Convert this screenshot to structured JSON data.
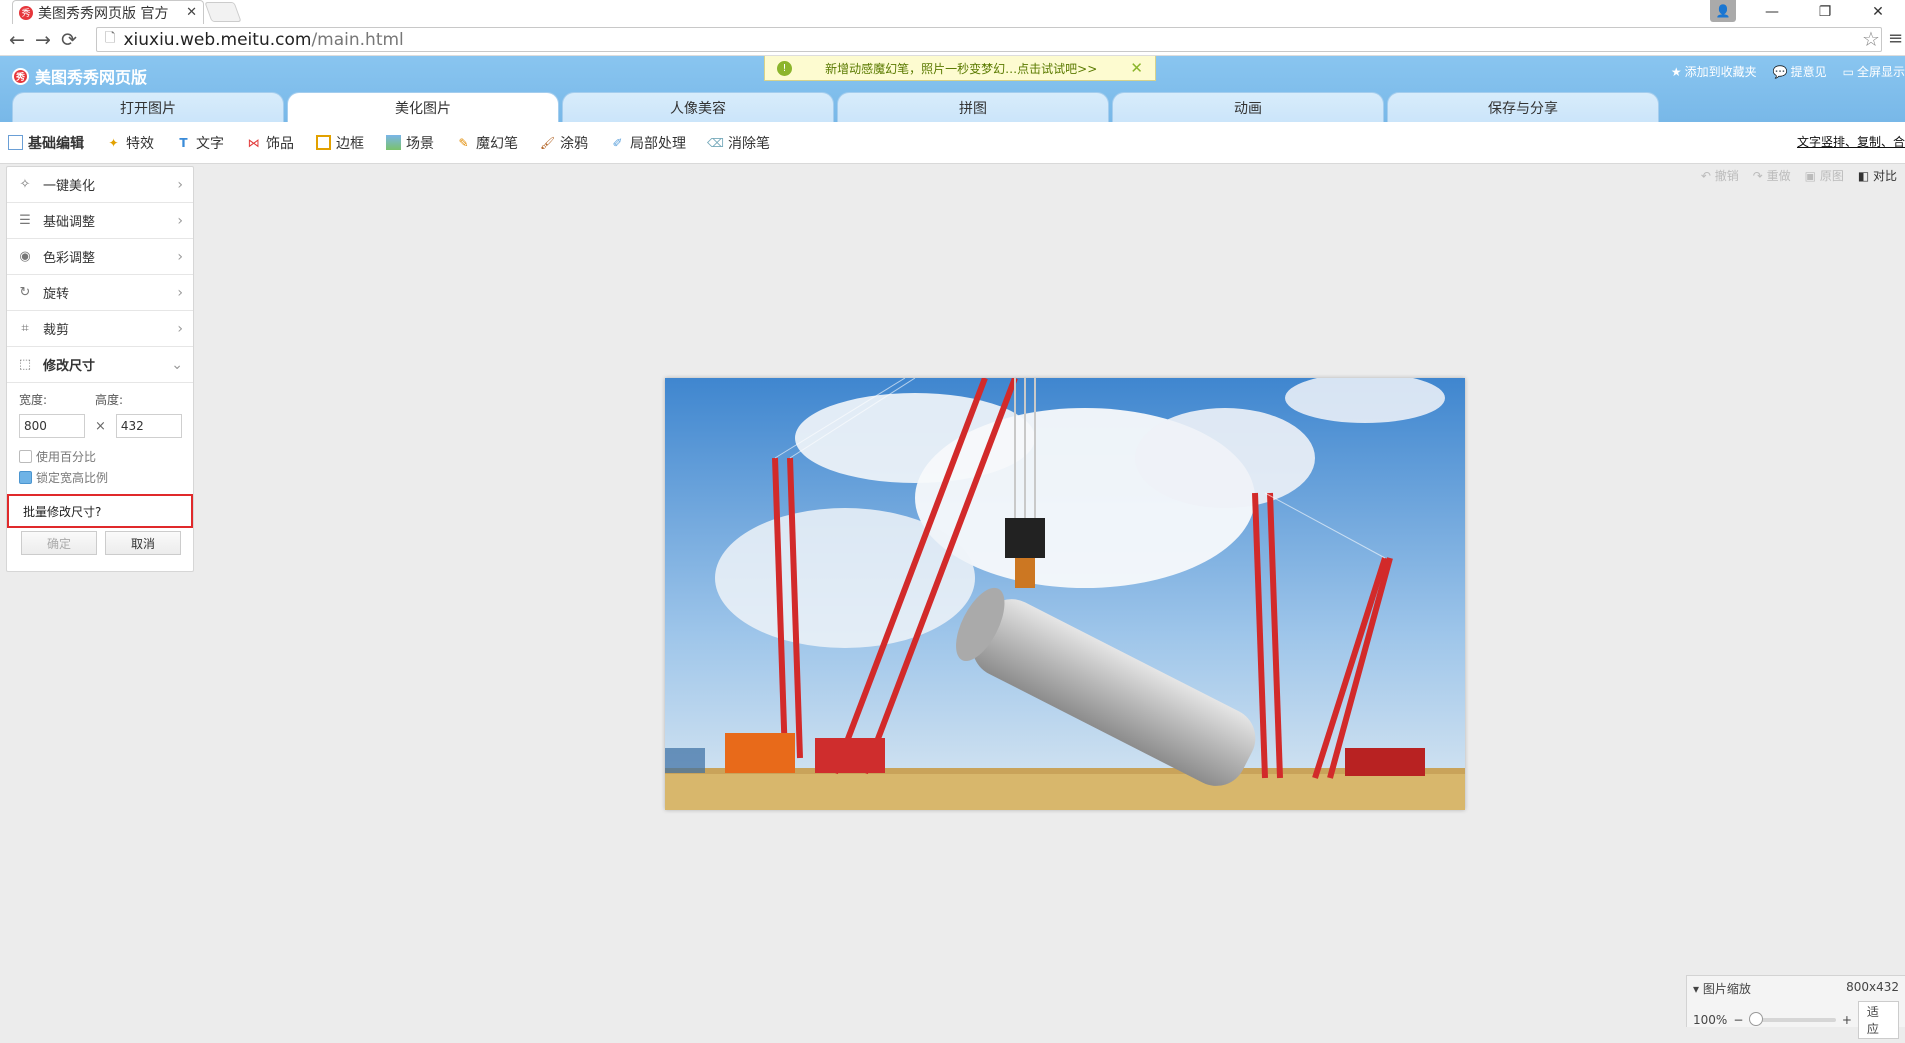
{
  "browser": {
    "tab_title": "美图秀秀网页版 官方",
    "tab_favicon": "秀",
    "url_host": "xiuxiu.web.meitu.com",
    "url_path": "/main.html",
    "win_min": "—",
    "win_restore": "❐",
    "win_close": "✕"
  },
  "app": {
    "brand": "美图秀秀网页版",
    "notice": "新增动感魔幻笔，照片一秒变梦幻…点击试试吧>>",
    "toplinks": [
      "添加到收藏夹",
      "提意见",
      "全屏显示"
    ],
    "tabs": [
      "打开图片",
      "美化图片",
      "人像美容",
      "拼图",
      "动画",
      "保存与分享"
    ],
    "active_tab": "美化图片"
  },
  "toolbar": {
    "items": [
      "基础编辑",
      "特效",
      "文字",
      "饰品",
      "边框",
      "场景",
      "魔幻笔",
      "涂鸦",
      "局部处理",
      "消除笔"
    ],
    "right_link": "文字竖排、复制、合"
  },
  "undo": {
    "items": [
      "撤销",
      "重做",
      "原图",
      "对比"
    ]
  },
  "panel": {
    "rows": [
      "一键美化",
      "基础调整",
      "色彩调整",
      "旋转",
      "裁剪",
      "修改尺寸"
    ],
    "width_label": "宽度:",
    "height_label": "高度:",
    "width_value": "800",
    "height_value": "432",
    "times": "×",
    "use_percent": "使用百分比",
    "lock_ratio": "锁定宽高比例",
    "batch": "批量修改尺寸?",
    "confirm": "确定",
    "cancel": "取消"
  },
  "zoom": {
    "title": "图片缩放",
    "size": "800x432",
    "percent": "100%",
    "fit": "适应"
  },
  "colors": {
    "appbar": "#7dbbe9",
    "highlight": "#e0292b",
    "sky": "#4f93d6",
    "crane": "#d22a2a"
  }
}
